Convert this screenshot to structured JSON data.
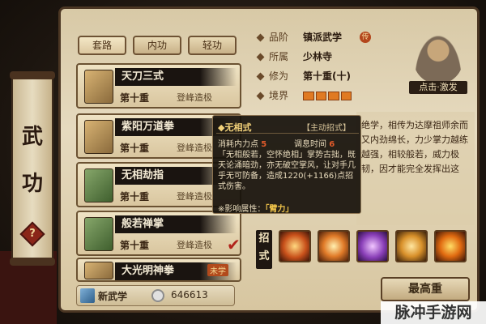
{
  "side": {
    "title": "武功",
    "help": "?"
  },
  "tabs": [
    {
      "label": "套路"
    },
    {
      "label": "内功"
    },
    {
      "label": "轻功"
    }
  ],
  "skills": [
    {
      "name": "天刀三式",
      "level": "第十重",
      "status": "登峰造极"
    },
    {
      "name": "紫阳万道拳",
      "level": "第十重",
      "status": "登峰造极"
    },
    {
      "name": "无相劫指",
      "level": "第十重",
      "status": "登峰造极"
    },
    {
      "name": "般若禅掌",
      "level": "第十重",
      "status": "登峰造极",
      "checked": true
    },
    {
      "name": "大光明神拳",
      "badge": "未学"
    }
  ],
  "info": {
    "rank_label": "品阶",
    "rank_value": "镇派武学",
    "rank_badge": "传",
    "sect_label": "所属",
    "sect_value": "少林寺",
    "level_label": "修为",
    "level_value": "第十重(十)",
    "realm_label": "境界"
  },
  "avatar": {
    "caption": "点击·激发"
  },
  "tooltip": {
    "name": "◆无相式",
    "type": "【主动招式】",
    "cost_label": "消耗内力点",
    "cost_value": "5",
    "cd_label": "调息时间",
    "cd_value": "6",
    "body": "「无相般若，空怀绝相」掌势古拙，既天论涌暗劲，亦无破空掌风，让对手几乎无可防备，造成1220(+1166)点招式伤害。",
    "effect_label": "※影响属性：",
    "effect_value": "「臂力」"
  },
  "description": "绝学，相传为达摩祖师余而又内劲绵长，力少掌力越练越强，相较般若，威力极韧，因才能完全发挥出这",
  "moves_title": "招式",
  "new_skill": {
    "label": "新武学",
    "value": "646613"
  },
  "max_button": "最高重",
  "watermark": "脉冲手游网"
}
